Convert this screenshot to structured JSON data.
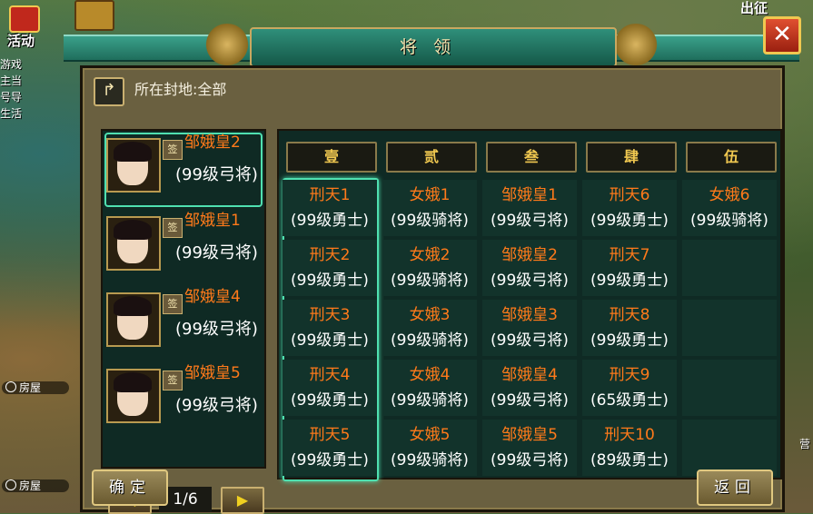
{
  "hud": {
    "event_label": "活动",
    "march_label": "出征",
    "side_text": [
      "游戏",
      "主当",
      "号导",
      "生活"
    ],
    "house_label_1": "房屋",
    "house_label_2": "房屋",
    "camp_text": "营"
  },
  "dialog": {
    "title": "将领",
    "close_glyph": "✕",
    "fief_label": "所在封地:全部",
    "back_glyph": "↱",
    "confirm_label": "确定",
    "return_label": "返回"
  },
  "general_list": {
    "sign_glyph": "签",
    "items": [
      {
        "name": "邹娥皇2",
        "info": "(99级弓将)"
      },
      {
        "name": "邹娥皇1",
        "info": "(99级弓将)"
      },
      {
        "name": "邹娥皇4",
        "info": "(99级弓将)"
      },
      {
        "name": "邹娥皇5",
        "info": "(99级弓将)"
      }
    ],
    "selected_index": 0,
    "page": "1/6",
    "prev_glyph": "◀",
    "next_glyph": "▶"
  },
  "formation": {
    "columns": [
      "壹",
      "贰",
      "叁",
      "肆",
      "伍"
    ],
    "selected_column": 0,
    "rows": [
      [
        {
          "name": "刑天1",
          "info": "(99级勇士)"
        },
        {
          "name": "女娥1",
          "info": "(99级骑将)"
        },
        {
          "name": "邹娥皇1",
          "info": "(99级弓将)"
        },
        {
          "name": "刑天6",
          "info": "(99级勇士)"
        },
        {
          "name": "女娥6",
          "info": "(99级骑将)"
        }
      ],
      [
        {
          "name": "刑天2",
          "info": "(99级勇士)"
        },
        {
          "name": "女娥2",
          "info": "(99级骑将)"
        },
        {
          "name": "邹娥皇2",
          "info": "(99级弓将)"
        },
        {
          "name": "刑天7",
          "info": "(99级勇士)"
        },
        {
          "name": "",
          "info": ""
        }
      ],
      [
        {
          "name": "刑天3",
          "info": "(99级勇士)"
        },
        {
          "name": "女娥3",
          "info": "(99级骑将)"
        },
        {
          "name": "邹娥皇3",
          "info": "(99级弓将)"
        },
        {
          "name": "刑天8",
          "info": "(99级勇士)"
        },
        {
          "name": "",
          "info": ""
        }
      ],
      [
        {
          "name": "刑天4",
          "info": "(99级勇士)"
        },
        {
          "name": "女娥4",
          "info": "(99级骑将)"
        },
        {
          "name": "邹娥皇4",
          "info": "(99级弓将)"
        },
        {
          "name": "刑天9",
          "info": "(65级勇士)"
        },
        {
          "name": "",
          "info": ""
        }
      ],
      [
        {
          "name": "刑天5",
          "info": "(99级勇士)"
        },
        {
          "name": "女娥5",
          "info": "(99级骑将)"
        },
        {
          "name": "邹娥皇5",
          "info": "(99级弓将)"
        },
        {
          "name": "刑天10",
          "info": "(89级勇士)"
        },
        {
          "name": "",
          "info": ""
        }
      ]
    ]
  }
}
